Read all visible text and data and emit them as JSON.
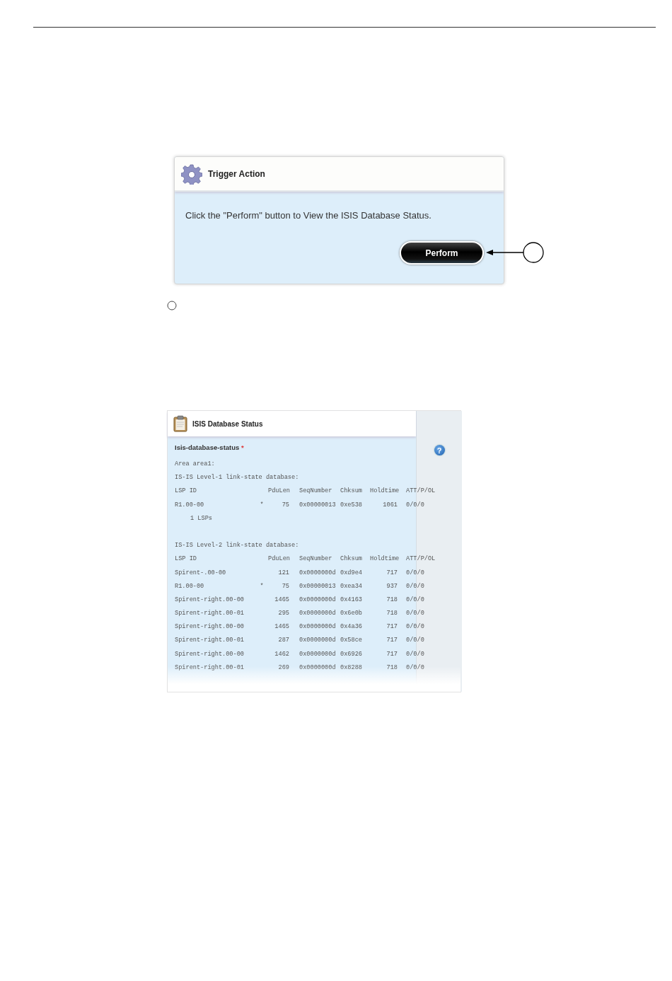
{
  "trigger_panel": {
    "title": "Trigger Action",
    "message": "Click the \"Perform\" button to View the ISIS Database Status.",
    "button": "Perform"
  },
  "status_panel": {
    "title": "ISIS Database Status",
    "field_label": "Isis-database-status",
    "required_mark": "*",
    "help": "?",
    "area": "Area area1:",
    "levels": [
      {
        "heading": "IS-IS Level-1 link-state database:",
        "columns": [
          "LSP ID",
          "PduLen",
          "SeqNumber",
          "Chksum",
          "Holdtime",
          "ATT/P/OL"
        ],
        "rows": [
          {
            "lsp_id": "R1.00-00",
            "own": "*",
            "pdu_len": "75",
            "seq": "0x00000013",
            "chksum": "0xe538",
            "holdtime": "1061",
            "flags": "0/0/0"
          }
        ],
        "summary": "1 LSPs"
      },
      {
        "heading": "IS-IS Level-2 link-state database:",
        "columns": [
          "LSP ID",
          "PduLen",
          "SeqNumber",
          "Chksum",
          "Holdtime",
          "ATT/P/OL"
        ],
        "rows": [
          {
            "lsp_id": "Spirent-.00-00",
            "pdu_len": "121",
            "seq": "0x0000000d",
            "chksum": "0xd9e4",
            "holdtime": "717",
            "flags": "0/0/0"
          },
          {
            "lsp_id": "R1.00-00",
            "own": "*",
            "pdu_len": "75",
            "seq": "0x00000013",
            "chksum": "0xea34",
            "holdtime": "937",
            "flags": "0/0/0"
          },
          {
            "lsp_id": "Spirent-right.00-00",
            "pdu_len": "1465",
            "seq": "0x0000000d",
            "chksum": "0x4163",
            "holdtime": "718",
            "flags": "0/0/0"
          },
          {
            "lsp_id": "Spirent-right.00-01",
            "pdu_len": "295",
            "seq": "0x0000000d",
            "chksum": "0x6e0b",
            "holdtime": "718",
            "flags": "0/0/0"
          },
          {
            "lsp_id": "Spirent-right.00-00",
            "pdu_len": "1465",
            "seq": "0x0000000d",
            "chksum": "0x4a36",
            "holdtime": "717",
            "flags": "0/0/0"
          },
          {
            "lsp_id": "Spirent-right.00-01",
            "pdu_len": "287",
            "seq": "0x0000000d",
            "chksum": "0x58ce",
            "holdtime": "717",
            "flags": "0/0/0"
          },
          {
            "lsp_id": "Spirent-right.00-00",
            "pdu_len": "1462",
            "seq": "0x0000000d",
            "chksum": "0x6926",
            "holdtime": "717",
            "flags": "0/0/0"
          },
          {
            "lsp_id": "Spirent-right.00-01",
            "pdu_len": "269",
            "seq": "0x0000000d",
            "chksum": "0x8288",
            "holdtime": "718",
            "flags": "0/0/0"
          }
        ]
      }
    ]
  }
}
